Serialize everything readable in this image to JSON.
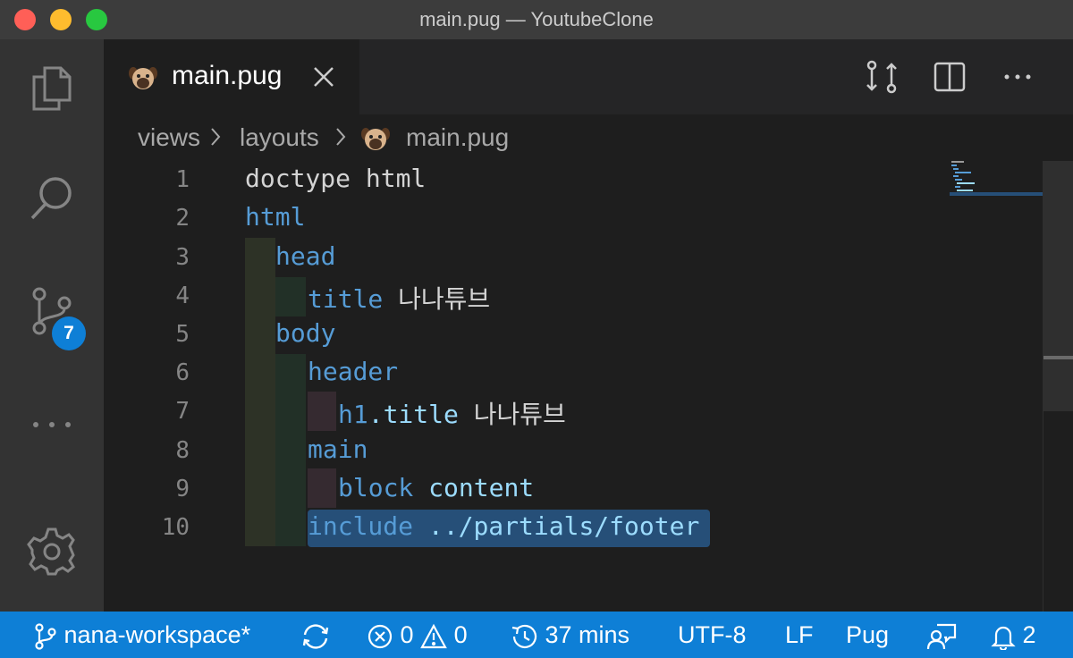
{
  "window": {
    "title": "main.pug — YoutubeClone"
  },
  "activity_bar": {
    "source_control_badge": "7"
  },
  "tab": {
    "label": "main.pug"
  },
  "breadcrumb": {
    "folder1": "views",
    "folder2": "layouts",
    "file": "main.pug"
  },
  "editor": {
    "line_numbers": [
      "1",
      "2",
      "3",
      "4",
      "5",
      "6",
      "7",
      "8",
      "9",
      "10"
    ],
    "lines": [
      {
        "t1": "doctype html"
      },
      {
        "t1": "html"
      },
      {
        "t1": "head"
      },
      {
        "t1": "title",
        "t2": " 나나튜브"
      },
      {
        "t1": "body"
      },
      {
        "t1": "header"
      },
      {
        "t1": "h1",
        "t2": ".title",
        "t3": " 나나튜브"
      },
      {
        "t1": "main"
      },
      {
        "t1": "block",
        "t2": " content"
      },
      {
        "t1": "include",
        "t2": " ../partials/footer"
      }
    ]
  },
  "status_bar": {
    "branch": "nana-workspace*",
    "errors": "0",
    "warnings": "0",
    "timer": "37 mins",
    "encoding": "UTF-8",
    "eol": "LF",
    "language": "Pug",
    "notifications": "2"
  },
  "colors": {
    "status_bar": "#0e7fd6",
    "keyword": "#569cd6",
    "selection": "#264f78"
  }
}
